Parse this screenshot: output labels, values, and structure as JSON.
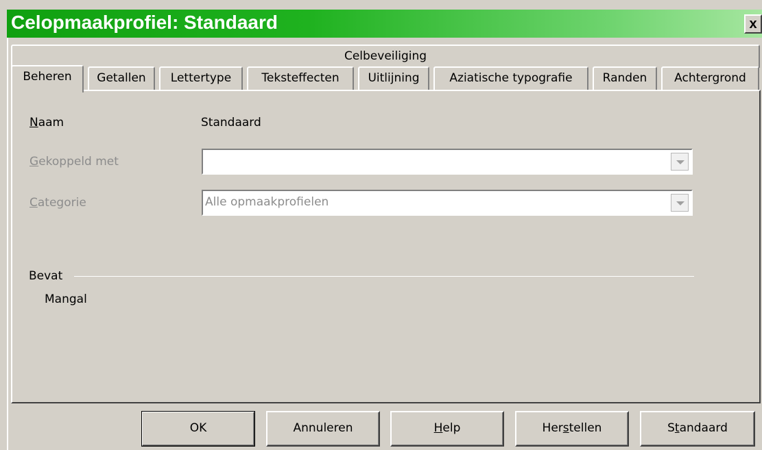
{
  "window": {
    "title": "Celopmaakprofiel: Standaard",
    "close_label": "x"
  },
  "tabs": {
    "back_row": [
      "Celbeveiliging"
    ],
    "front_row": [
      "Beheren",
      "Getallen",
      "Lettertype",
      "Teksteffecten",
      "Uitlijning",
      "Aziatische typografie",
      "Randen",
      "Achtergrond"
    ],
    "active": "Beheren"
  },
  "form": {
    "name_label": {
      "mnemonic": "N",
      "rest": "aam"
    },
    "name_value": "Standaard",
    "linked_label": {
      "mnemonic": "G",
      "rest": "ekoppeld met"
    },
    "linked_value": "",
    "category_label": {
      "mnemonic": "C",
      "rest": "ategorie"
    },
    "category_value": "Alle opmaakprofielen",
    "contains_label": "Bevat",
    "contains_value": "Mangal"
  },
  "buttons": {
    "ok": "OK",
    "cancel": "Annuleren",
    "help": {
      "mnemonic": "H",
      "rest": "elp"
    },
    "reset": {
      "before": "Her",
      "mnemonic": "s",
      "after": "tellen"
    },
    "standard": {
      "before": "S",
      "mnemonic": "t",
      "after": "andaard"
    }
  },
  "colors": {
    "titlebar_start": "#10a010",
    "titlebar_end": "#a6e6a0",
    "dialog_face": "#d4d0c8",
    "disabled_text": "#8c8c8c"
  }
}
